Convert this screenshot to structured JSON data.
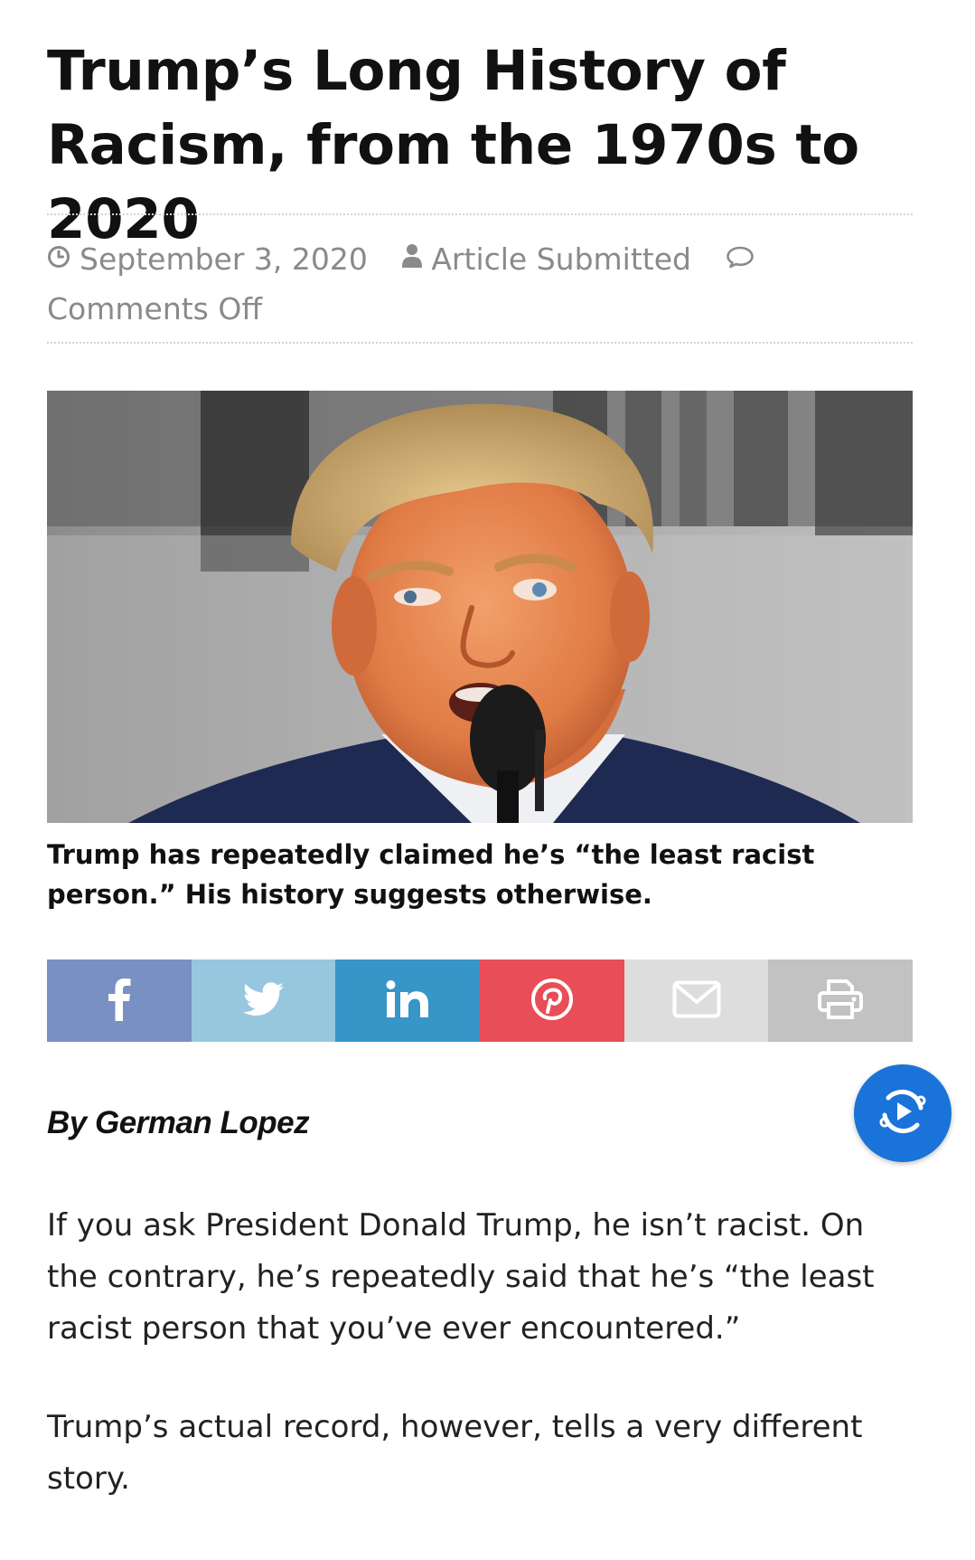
{
  "article": {
    "title": "Trump’s Long History of Racism, from the 1970s to 2020",
    "meta": {
      "date": "September 3, 2020",
      "author": "Article Submitted",
      "comments": "Comments Off"
    },
    "image_caption": "Trump has repeatedly claimed he’s “the least racist person.” His history suggests otherwise.",
    "byline": "By German Lopez",
    "paragraphs": [
      "If you ask President Donald Trump, he isn’t racist. On the contrary, he’s repeatedly said that he’s “the least racist person that you’ve ever encountered.”",
      "Trump’s actual record, however, tells a very different story."
    ]
  },
  "share": {
    "buttons": [
      {
        "icon": "facebook-icon",
        "color": "#7990c2"
      },
      {
        "icon": "twitter-icon",
        "color": "#96c7df"
      },
      {
        "icon": "linkedin-icon",
        "color": "#3795c8"
      },
      {
        "icon": "pinterest-icon",
        "color": "#e94d57"
      },
      {
        "icon": "email-icon",
        "color": "#dddddd"
      },
      {
        "icon": "print-icon",
        "color": "#c2c2c2"
      }
    ]
  },
  "floating_button": {
    "icon": "video-replay-icon",
    "color": "#1a73d9"
  }
}
